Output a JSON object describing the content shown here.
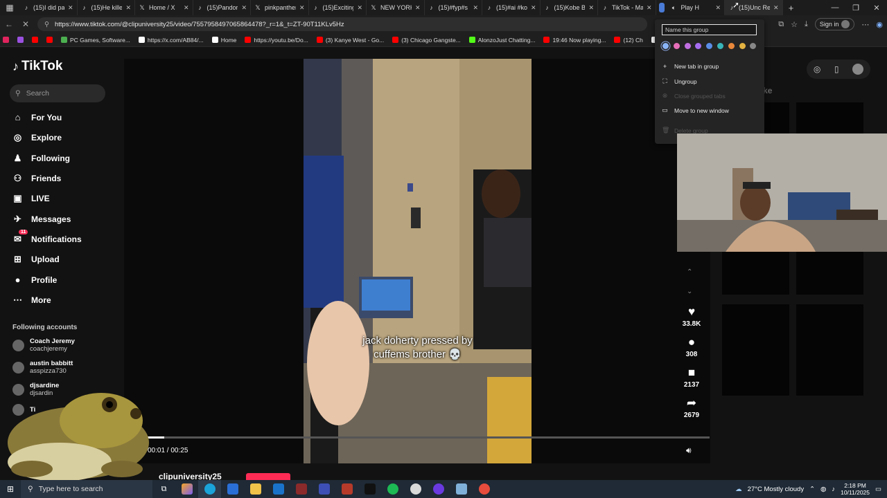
{
  "tabs": [
    {
      "title": "(15)I did pa",
      "favicon": "tiktok-icon"
    },
    {
      "title": "(15)He kille",
      "favicon": "tiktok-icon"
    },
    {
      "title": "Home / X",
      "favicon": "x-icon"
    },
    {
      "title": "(15)Pandora",
      "favicon": "tiktok-icon"
    },
    {
      "title": "pinkpanther",
      "favicon": "x-icon"
    },
    {
      "title": "(15)Exciting",
      "favicon": "tiktok-icon"
    },
    {
      "title": "NEW YORK",
      "favicon": "x-icon"
    },
    {
      "title": "(15)#fyp#s",
      "favicon": "tiktok-icon"
    },
    {
      "title": "(15)#ai #ko",
      "favicon": "tiktok-icon"
    },
    {
      "title": "(15)Kobe Br",
      "favicon": "tiktok-icon"
    },
    {
      "title": "TikTok - Ma",
      "favicon": "tiktok-icon"
    }
  ],
  "grouped_tabs": [
    {
      "title": "Play H",
      "favicon": "speaker-icon"
    },
    {
      "title": "(15)Unc Re",
      "favicon": "tiktok-icon"
    }
  ],
  "address": {
    "url": "https://www.tiktok.com/@clipuniversity25/video/7557958497065864478?_r=1&_t=ZT-90T11KLv5Hz",
    "signin_label": "Sign in"
  },
  "bookmarks": [
    {
      "label": "",
      "color": "#e0245e"
    },
    {
      "label": "",
      "color": "#9b51e0"
    },
    {
      "label": "",
      "color": "#ff0000"
    },
    {
      "label": "",
      "color": "#ff0000"
    },
    {
      "label": "PC Games, Software...",
      "color": "#4caf50"
    },
    {
      "label": "https://x.com/AB84/...",
      "color": "#ffffff"
    },
    {
      "label": "Home",
      "color": "#ffffff"
    },
    {
      "label": "https://youtu.be/Do...",
      "color": "#ff0000"
    },
    {
      "label": "(3) Kanye West - Go...",
      "color": "#ff0000"
    },
    {
      "label": "(3) Chicago Gangste...",
      "color": "#ff0000"
    },
    {
      "label": "AlonzoJust Chatting...",
      "color": "#53fc18"
    },
    {
      "label": "19:46 Now playing...",
      "color": "#ff0000"
    },
    {
      "label": "(12) Ch",
      "color": "#ff0000"
    },
    {
      "label": "https://www.tiktok.c...",
      "color": "#ffffff"
    }
  ],
  "tiktok": {
    "logo": "TikTok",
    "search_placeholder": "Search",
    "nav": [
      {
        "label": "For You",
        "icon": "home-icon",
        "active": false
      },
      {
        "label": "Explore",
        "icon": "compass-icon",
        "active": false
      },
      {
        "label": "Following",
        "icon": "following-icon",
        "active": false
      },
      {
        "label": "Friends",
        "icon": "friends-icon",
        "active": false
      },
      {
        "label": "LIVE",
        "icon": "live-icon",
        "active": false
      },
      {
        "label": "Messages",
        "icon": "messages-icon",
        "active": false
      },
      {
        "label": "Notifications",
        "icon": "inbox-icon",
        "active": false,
        "badge": "11"
      },
      {
        "label": "Upload",
        "icon": "upload-icon",
        "active": false
      },
      {
        "label": "Profile",
        "icon": "avatar",
        "active": false
      },
      {
        "label": "More",
        "icon": "more-icon",
        "active": false
      }
    ],
    "following_title": "Following accounts",
    "following": [
      {
        "name": "Coach Jeremy",
        "handle": "coachjeremy"
      },
      {
        "name": "austin babbitt",
        "handle": "asspizza730"
      },
      {
        "name": "djsardine",
        "handle": "djsardin"
      },
      {
        "name": "Ti",
        "handle": ""
      },
      {
        "name": "",
        "handle": ""
      }
    ],
    "video": {
      "caption_line1": "jack doherty pressed by",
      "caption_line2": "cuffems brother 💀",
      "time": "00:01 / 00:25",
      "progress": 0.03,
      "creator": "clipuniversity25"
    },
    "actions": [
      {
        "icon": "heart-icon",
        "count": "33.8K"
      },
      {
        "icon": "comment-icon",
        "count": "308"
      },
      {
        "icon": "bookmark-icon",
        "count": "2137"
      },
      {
        "icon": "share-icon",
        "count": "2679"
      }
    ],
    "you_may_like": "You may like"
  },
  "tab_group_menu": {
    "name_placeholder": "Name this group",
    "colors": [
      "#8ab4f8",
      "#e76fb9",
      "#c06ee0",
      "#a66cf0",
      "#5a8de8",
      "#38b4b8",
      "#e9883a",
      "#e3b341",
      "#888888"
    ],
    "items": [
      {
        "label": "New tab in group",
        "icon": "plus-icon",
        "disabled": false
      },
      {
        "label": "Ungroup",
        "icon": "ungroup-icon",
        "disabled": false
      },
      {
        "label": "Close grouped tabs",
        "icon": "close-tabs-icon",
        "disabled": true
      },
      {
        "label": "Move to new window",
        "icon": "new-window-icon",
        "disabled": false
      },
      {
        "label": "Delete group",
        "icon": "delete-icon",
        "disabled": true
      }
    ]
  },
  "taskbar": {
    "search_placeholder": "Type here to search",
    "weather": "27°C  Mostly cloudy",
    "time": "2:18 PM",
    "date": "10/11/2025"
  }
}
